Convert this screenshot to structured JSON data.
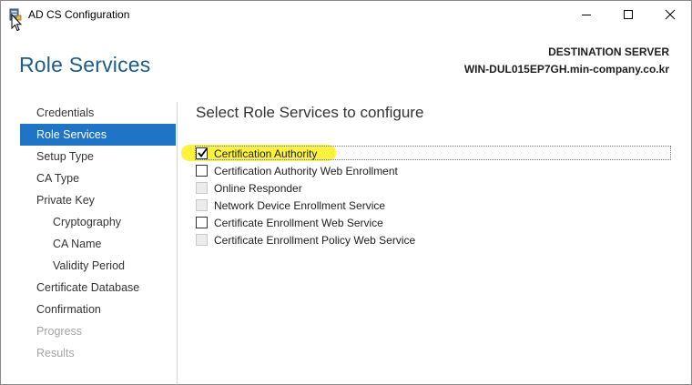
{
  "window": {
    "title": "AD CS Configuration"
  },
  "header": {
    "page_title": "Role Services",
    "destination_label": "DESTINATION SERVER",
    "destination_server": "WIN-DUL015EP7GH.min-company.co.kr"
  },
  "nav": {
    "items": [
      {
        "label": "Credentials",
        "state": "normal"
      },
      {
        "label": "Role Services",
        "state": "active"
      },
      {
        "label": "Setup Type",
        "state": "normal"
      },
      {
        "label": "CA Type",
        "state": "normal"
      },
      {
        "label": "Private Key",
        "state": "normal"
      },
      {
        "label": "Cryptography",
        "state": "normal"
      },
      {
        "label": "CA Name",
        "state": "normal"
      },
      {
        "label": "Validity Period",
        "state": "normal"
      },
      {
        "label": "Certificate Database",
        "state": "normal"
      },
      {
        "label": "Confirmation",
        "state": "normal"
      },
      {
        "label": "Progress",
        "state": "disabled"
      },
      {
        "label": "Results",
        "state": "disabled"
      }
    ]
  },
  "content": {
    "title": "Select Role Services to configure",
    "roles": [
      {
        "label": "Certification Authority",
        "checked": true,
        "enabled": true
      },
      {
        "label": "Certification Authority Web Enrollment",
        "checked": false,
        "enabled": true
      },
      {
        "label": "Online Responder",
        "checked": false,
        "enabled": false
      },
      {
        "label": "Network Device Enrollment Service",
        "checked": false,
        "enabled": false
      },
      {
        "label": "Certificate Enrollment Web Service",
        "checked": false,
        "enabled": true
      },
      {
        "label": "Certificate Enrollment Policy Web Service",
        "checked": false,
        "enabled": false
      }
    ]
  },
  "colors": {
    "accent": "#1f74c6",
    "title_blue": "#1e5c8a",
    "highlight": "#fdf232"
  },
  "icons": {
    "app": "server-certificate-icon",
    "minimize": "minimize-icon",
    "maximize": "maximize-icon",
    "close": "close-icon"
  }
}
